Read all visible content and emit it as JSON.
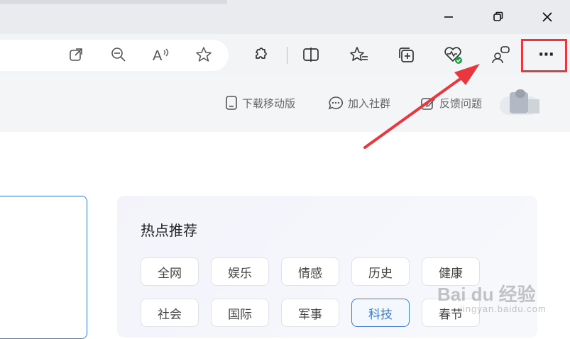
{
  "browser": {
    "window_controls": [
      "minimize",
      "restore",
      "close"
    ],
    "toolbar_icons": [
      "open-in-app-icon",
      "zoom-out-icon",
      "read-aloud-icon",
      "favorite-star-icon",
      "extensions-icon",
      "split-screen-icon",
      "favorites-icon",
      "collections-icon",
      "browser-essentials-icon",
      "copilot-profile-icon",
      "more-menu-icon"
    ],
    "read_aloud_glyph": "A",
    "more_glyph": "···"
  },
  "header": {
    "download_label": "下载移动版",
    "community_label": "加入社群",
    "feedback_label": "反馈问题"
  },
  "hot": {
    "title": "热点推荐",
    "chips": [
      "全网",
      "娱乐",
      "情感",
      "历史",
      "健康",
      "社会",
      "国际",
      "军事",
      "科技",
      "春节"
    ],
    "active_chip": "科技"
  },
  "colors": {
    "accent": "#3d7bd6",
    "annotation_red": "#e8373f"
  },
  "watermark": {
    "main": "Bai du 经验",
    "sub": "jingyan.baidu.com"
  }
}
